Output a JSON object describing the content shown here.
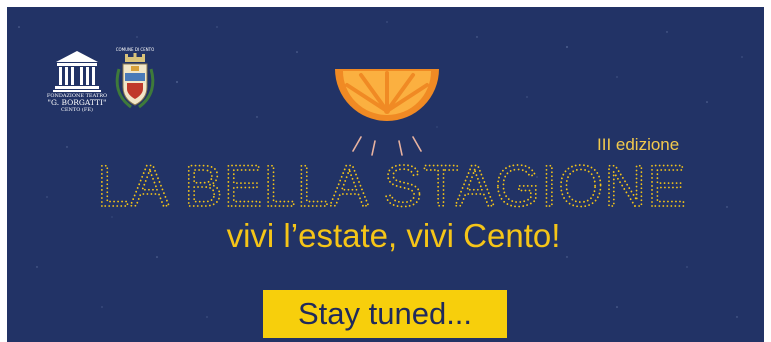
{
  "logos": {
    "teatro": {
      "line1": "FONDAZIONE TEATRO",
      "line2": "\"G. BORGATTI\"",
      "line3": "CENTO (FE)"
    },
    "comune": {
      "line1": "COMUNE DI CENTO"
    }
  },
  "headline": {
    "edition": "III edizione",
    "title": "LA BELLA STAGIONE",
    "tagline": "vivi l’estate, vivi Cento!"
  },
  "cta": {
    "label": "Stay tuned..."
  },
  "colors": {
    "background": "#223366",
    "accent_yellow": "#f5c518",
    "button_yellow": "#f7cf0c",
    "orange": "#f08a24",
    "button_text": "#1f2a5c"
  },
  "icons": {
    "orange": "orange-slice-icon",
    "teatro": "theatre-building-icon",
    "comune": "coat-of-arms-icon"
  }
}
